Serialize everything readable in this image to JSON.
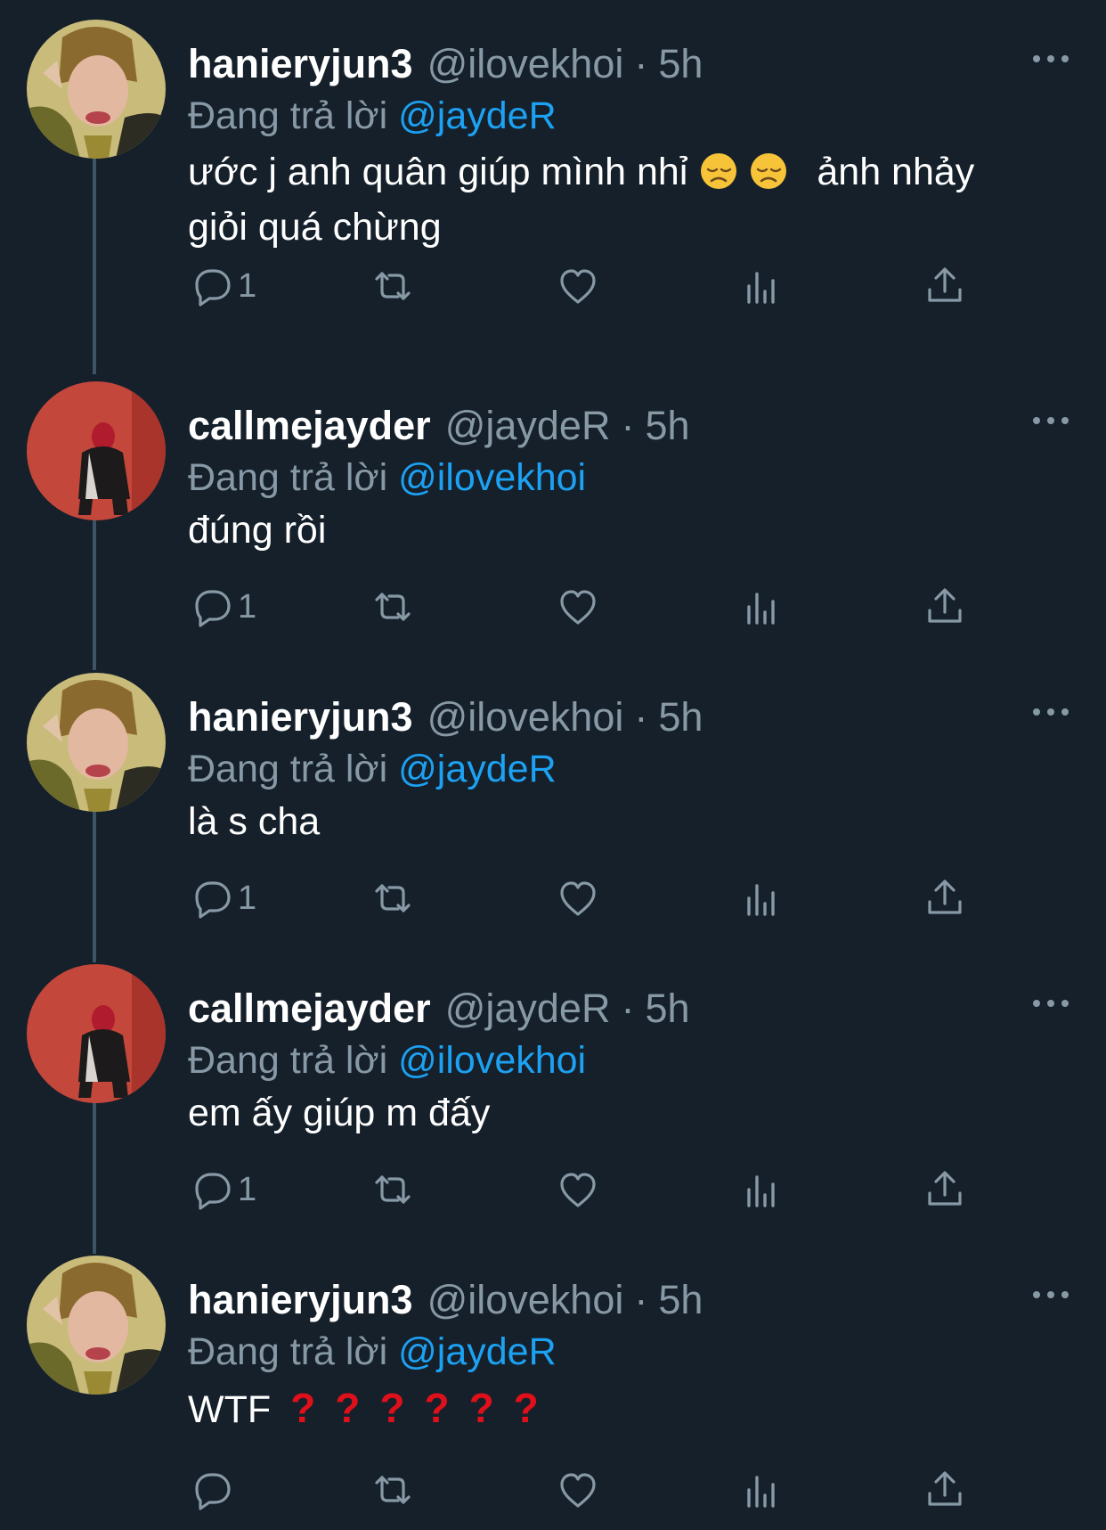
{
  "tweets": [
    {
      "name": "hanieryjun3",
      "handle": "@ilovekhoi",
      "separator": "·",
      "time": "5h",
      "reply_prefix": "Đang trả lời",
      "reply_to": "@jaydeR",
      "avatar": "avatar-hanieryjun3",
      "text_parts": [
        "ước j anh quân giúp mình nhỉ",
        "ảnh nhảy",
        "giỏi quá chừng"
      ],
      "emojis": [
        "disappointed-face-emoji",
        "disappointed-face-emoji"
      ],
      "reply_count": "1"
    },
    {
      "name": "callmejayder",
      "handle": "@jaydeR",
      "separator": "·",
      "time": "5h",
      "reply_prefix": "Đang trả lời",
      "reply_to": "@ilovekhoi",
      "avatar": "avatar-callmejayder",
      "text": "đúng rồi",
      "reply_count": "1"
    },
    {
      "name": "hanieryjun3",
      "handle": "@ilovekhoi",
      "separator": "·",
      "time": "5h",
      "reply_prefix": "Đang trả lời",
      "reply_to": "@jaydeR",
      "avatar": "avatar-hanieryjun3",
      "text": "là s cha",
      "reply_count": "1"
    },
    {
      "name": "callmejayder",
      "handle": "@jaydeR",
      "separator": "·",
      "time": "5h",
      "reply_prefix": "Đang trả lời",
      "reply_to": "@ilovekhoi",
      "avatar": "avatar-callmejayder",
      "text": "em ấy giúp m đấy",
      "reply_count": "1"
    },
    {
      "name": "hanieryjun3",
      "handle": "@ilovekhoi",
      "separator": "·",
      "time": "5h",
      "reply_prefix": "Đang trả lời",
      "reply_to": "@jaydeR",
      "avatar": "avatar-hanieryjun3",
      "text": "WTF",
      "question_marks": [
        "?",
        "?",
        "?",
        "?",
        "?",
        "?"
      ],
      "reply_count": ""
    }
  ],
  "icons": {
    "reply": "reply-icon",
    "retweet": "retweet-icon",
    "like": "like-icon",
    "analytics": "analytics-icon",
    "share": "share-icon",
    "more": "more-icon"
  },
  "colors": {
    "background": "#15202b",
    "muted": "#8899a6",
    "mention": "#1da1f2",
    "thread_line": "#3d5466",
    "question_mark": "#e0101a"
  }
}
